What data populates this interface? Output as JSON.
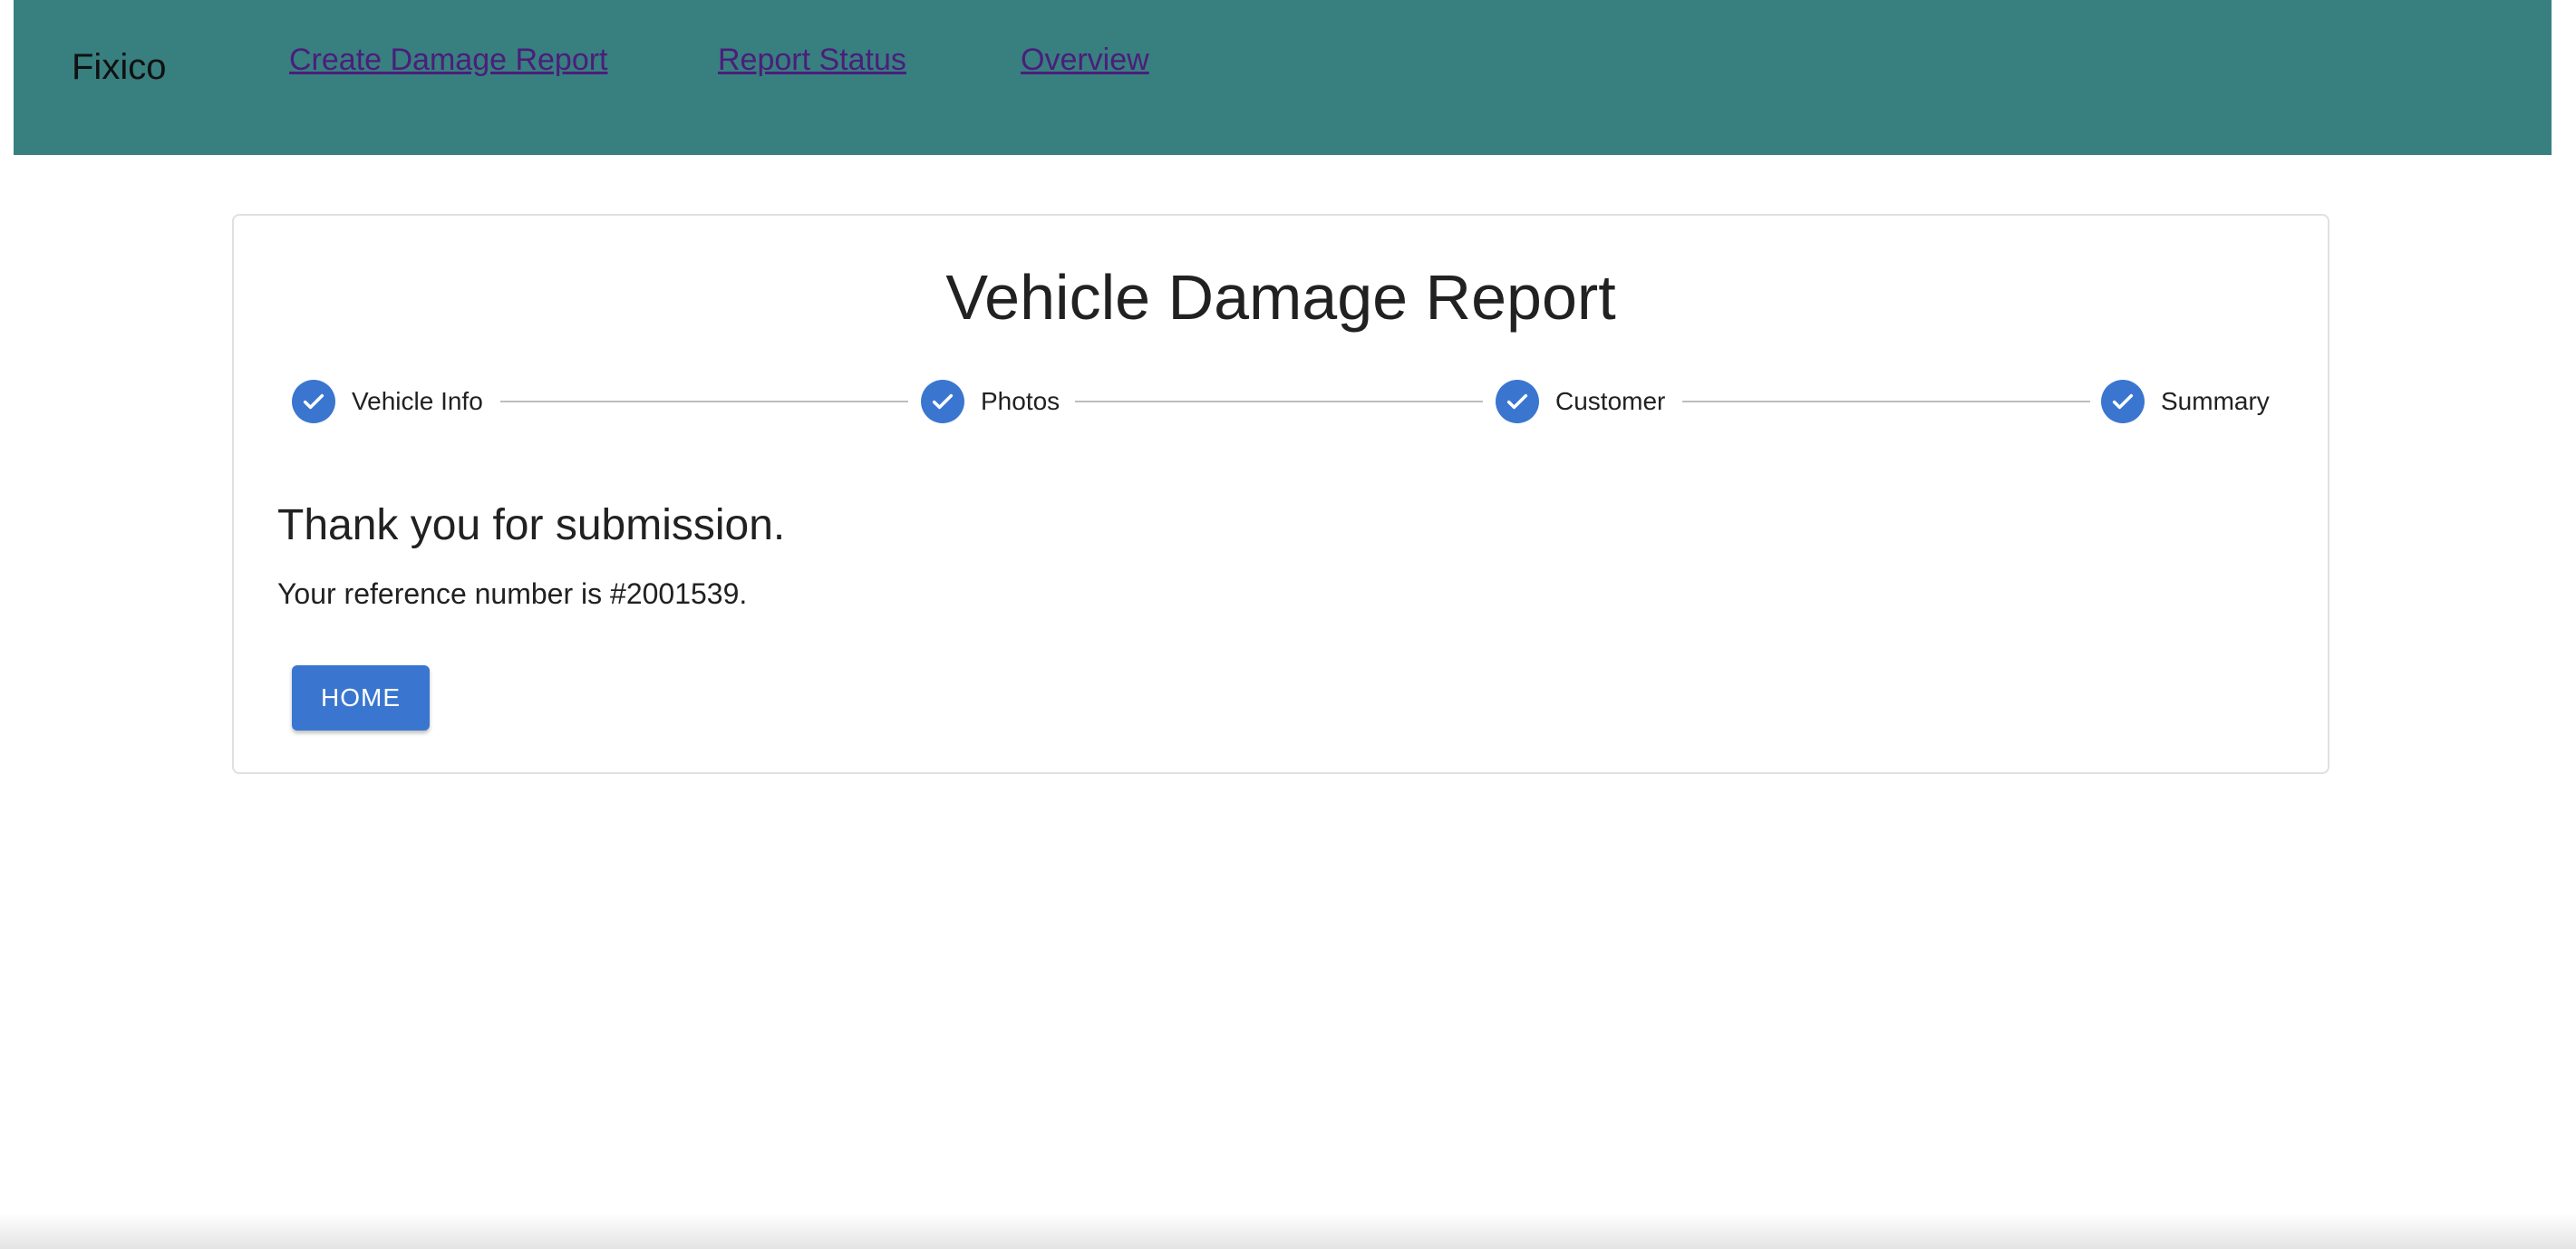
{
  "header": {
    "brand": "Fixico",
    "nav": [
      {
        "label": "Create Damage Report"
      },
      {
        "label": "Report Status"
      },
      {
        "label": "Overview"
      }
    ],
    "background_color": "#387f80",
    "link_color": "#4a1e7a"
  },
  "card": {
    "title": "Vehicle Damage Report",
    "steps": [
      {
        "label": "Vehicle Info",
        "state": "completed",
        "icon": "check-icon"
      },
      {
        "label": "Photos",
        "state": "completed",
        "icon": "check-icon"
      },
      {
        "label": "Customer",
        "state": "completed",
        "icon": "check-icon"
      },
      {
        "label": "Summary",
        "state": "completed",
        "icon": "check-icon"
      }
    ],
    "accent_color": "#3a76d0",
    "message": {
      "heading": "Thank you for submission.",
      "reference": "Your reference number is #2001539."
    },
    "home_button_label": "HOME"
  }
}
